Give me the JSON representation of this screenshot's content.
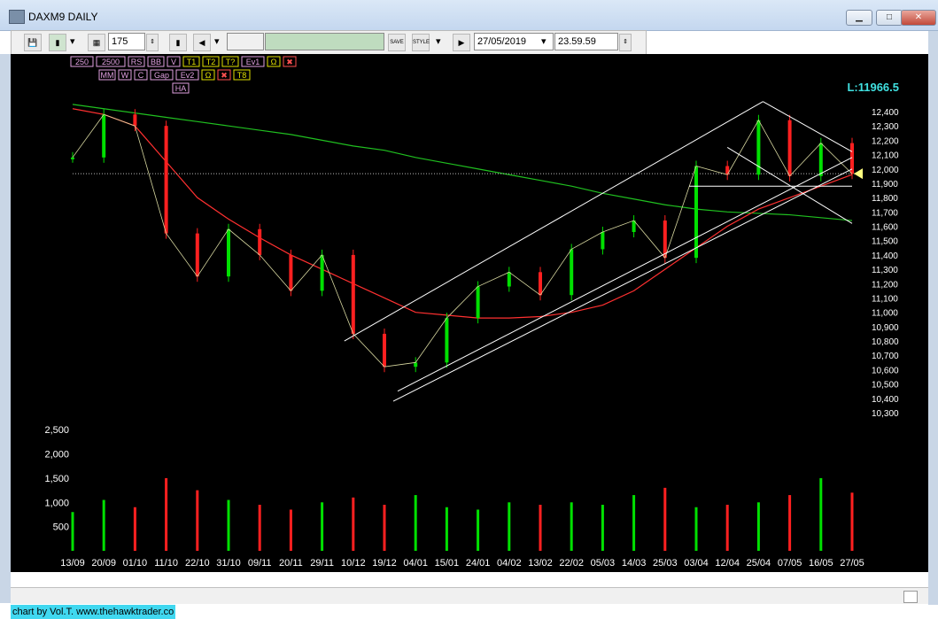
{
  "window": {
    "title": "DAXM9 DAILY",
    "minimize": "▁",
    "maximize": "□",
    "close": "✕"
  },
  "toolbar": {
    "bars_value": "175",
    "date_value": "27/05/2019",
    "time_value": "23.59.59",
    "save_label": "SAVE",
    "style_label": "STYLE"
  },
  "indicator_bar": {
    "row1": [
      "250",
      "2500",
      "RS",
      "BB",
      "V",
      "T1",
      "T2",
      "T?",
      "Ev1",
      "Ω",
      "✖"
    ],
    "row2": [
      "MM",
      "W",
      "C",
      "Gap",
      "Ev2",
      "Ω",
      "✖",
      "T8"
    ],
    "row3": [
      "HA"
    ]
  },
  "last_price_label": "L:11966.5",
  "credit": "chart by Vol.T. www.thehawktrader.co",
  "colors": {
    "up": "#00e000",
    "down": "#ff2020",
    "ma_red": "#ff3030",
    "ma_green": "#20c020",
    "channel": "#ffffff",
    "accent_cyan": "#40e0e0"
  },
  "chart_data": {
    "type": "line",
    "title": "DAXM9 DAILY",
    "price_axis": {
      "ticks": [
        "12,400",
        "12,300",
        "12,200",
        "12,100",
        "12,000",
        "11,900",
        "11,800",
        "11,700",
        "11,600",
        "11,500",
        "11,400",
        "11,300",
        "11,200",
        "11,100",
        "11,000",
        "10,900",
        "10,800",
        "10,700",
        "10,600",
        "10,500",
        "10,400",
        "10,300"
      ],
      "range": [
        10300,
        12400
      ]
    },
    "volume_axis": {
      "ticks": [
        "2,500",
        "2,000",
        "1,500",
        "1,000",
        "500"
      ],
      "range": [
        0,
        2500
      ]
    },
    "x_ticks": [
      "13/09",
      "20/09",
      "01/10",
      "11/10",
      "22/10",
      "31/10",
      "09/11",
      "20/11",
      "29/11",
      "10/12",
      "19/12",
      "04/01",
      "15/01",
      "24/01",
      "04/02",
      "13/02",
      "22/02",
      "05/03",
      "14/03",
      "25/03",
      "03/04",
      "12/04",
      "25/04",
      "07/05",
      "16/05",
      "27/05"
    ],
    "close_series": [
      {
        "d": "13/09",
        "v": 12080
      },
      {
        "d": "20/09",
        "v": 12380
      },
      {
        "d": "01/10",
        "v": 12300
      },
      {
        "d": "11/10",
        "v": 11550
      },
      {
        "d": "22/10",
        "v": 11250
      },
      {
        "d": "31/10",
        "v": 11580
      },
      {
        "d": "09/11",
        "v": 11400
      },
      {
        "d": "20/11",
        "v": 11150
      },
      {
        "d": "29/11",
        "v": 11400
      },
      {
        "d": "10/12",
        "v": 10850
      },
      {
        "d": "19/12",
        "v": 10620
      },
      {
        "d": "04/01",
        "v": 10650
      },
      {
        "d": "15/01",
        "v": 10960
      },
      {
        "d": "24/01",
        "v": 11180
      },
      {
        "d": "04/02",
        "v": 11280
      },
      {
        "d": "13/02",
        "v": 11120
      },
      {
        "d": "22/02",
        "v": 11440
      },
      {
        "d": "05/03",
        "v": 11560
      },
      {
        "d": "14/03",
        "v": 11640
      },
      {
        "d": "25/03",
        "v": 11380
      },
      {
        "d": "03/04",
        "v": 12020
      },
      {
        "d": "12/04",
        "v": 11960
      },
      {
        "d": "25/04",
        "v": 12340
      },
      {
        "d": "07/05",
        "v": 11950
      },
      {
        "d": "16/05",
        "v": 12180
      },
      {
        "d": "27/05",
        "v": 11966
      }
    ],
    "ma_red": [
      12420,
      12380,
      12300,
      12050,
      11800,
      11650,
      11520,
      11400,
      11300,
      11200,
      11100,
      11000,
      10980,
      10960,
      10960,
      10970,
      11000,
      11050,
      11150,
      11300,
      11450,
      11600,
      11720,
      11800,
      11880,
      11960
    ],
    "ma_green": [
      12450,
      12420,
      12390,
      12360,
      12330,
      12300,
      12270,
      12240,
      12200,
      12160,
      12130,
      12080,
      12040,
      12000,
      11960,
      11920,
      11880,
      11830,
      11790,
      11750,
      11720,
      11700,
      11690,
      11680,
      11660,
      11640
    ],
    "volume": [
      800,
      1050,
      900,
      1500,
      1250,
      1050,
      950,
      850,
      1000,
      1100,
      950,
      1150,
      900,
      850,
      1000,
      950,
      1000,
      950,
      1150,
      1300,
      900,
      950,
      1000,
      1150,
      1500,
      1200
    ],
    "reference_level": 11966.5
  }
}
